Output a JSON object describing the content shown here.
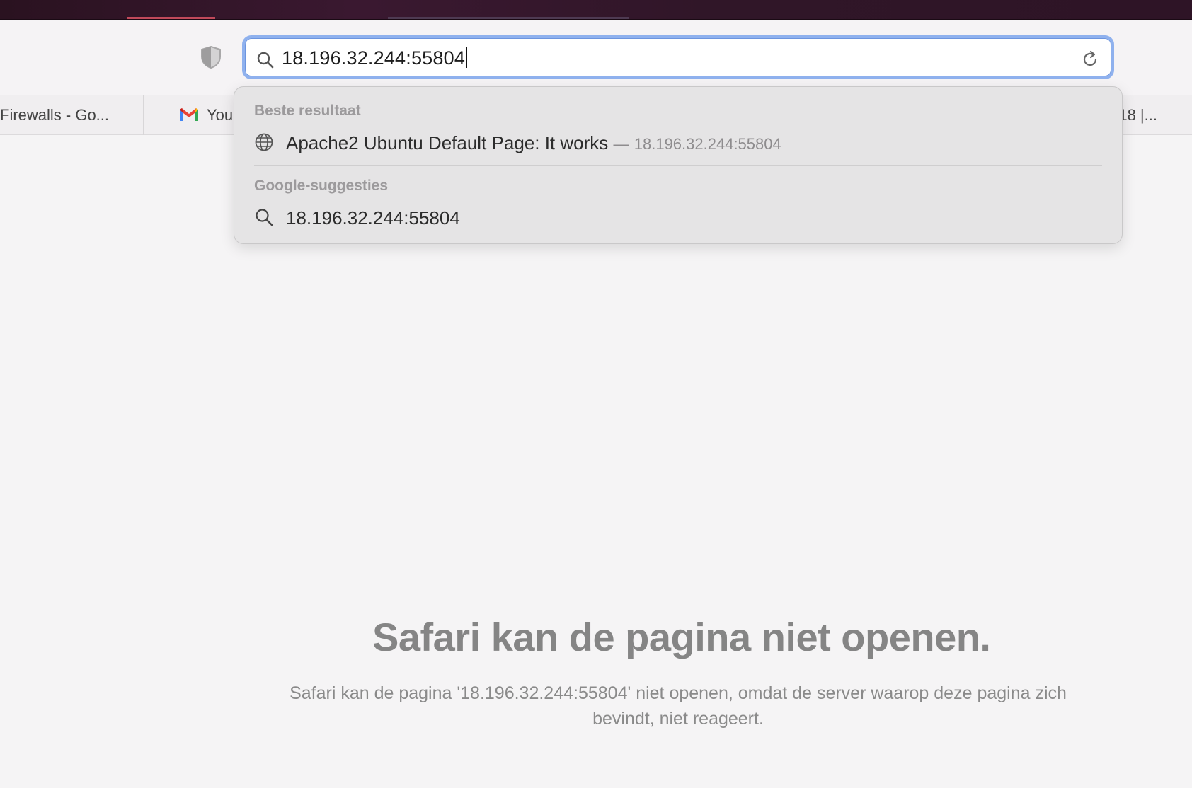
{
  "address_bar": {
    "url": "18.196.32.244:55804"
  },
  "favorites": [
    {
      "label": "Firewalls - Go..."
    },
    {
      "label": "You"
    },
    {
      "label": "u 18 |..."
    }
  ],
  "dropdown": {
    "best_result_header": "Beste resultaat",
    "best_result": {
      "title": "Apache2 Ubuntu Default Page: It works",
      "separator": "—",
      "url": "18.196.32.244:55804",
      "icon": "globe-icon"
    },
    "suggestions_header": "Google-suggesties",
    "suggestion": {
      "text": "18.196.32.244:55804",
      "icon": "search-icon"
    }
  },
  "error_page": {
    "title": "Safari kan de pagina niet openen.",
    "message": "Safari kan de pagina '18.196.32.244:55804' niet openen, omdat de server waarop deze pagina zich bevindt, niet reageert."
  },
  "colors": {
    "focus_ring": "#8fb1ee",
    "background": "#f5f4f5"
  }
}
